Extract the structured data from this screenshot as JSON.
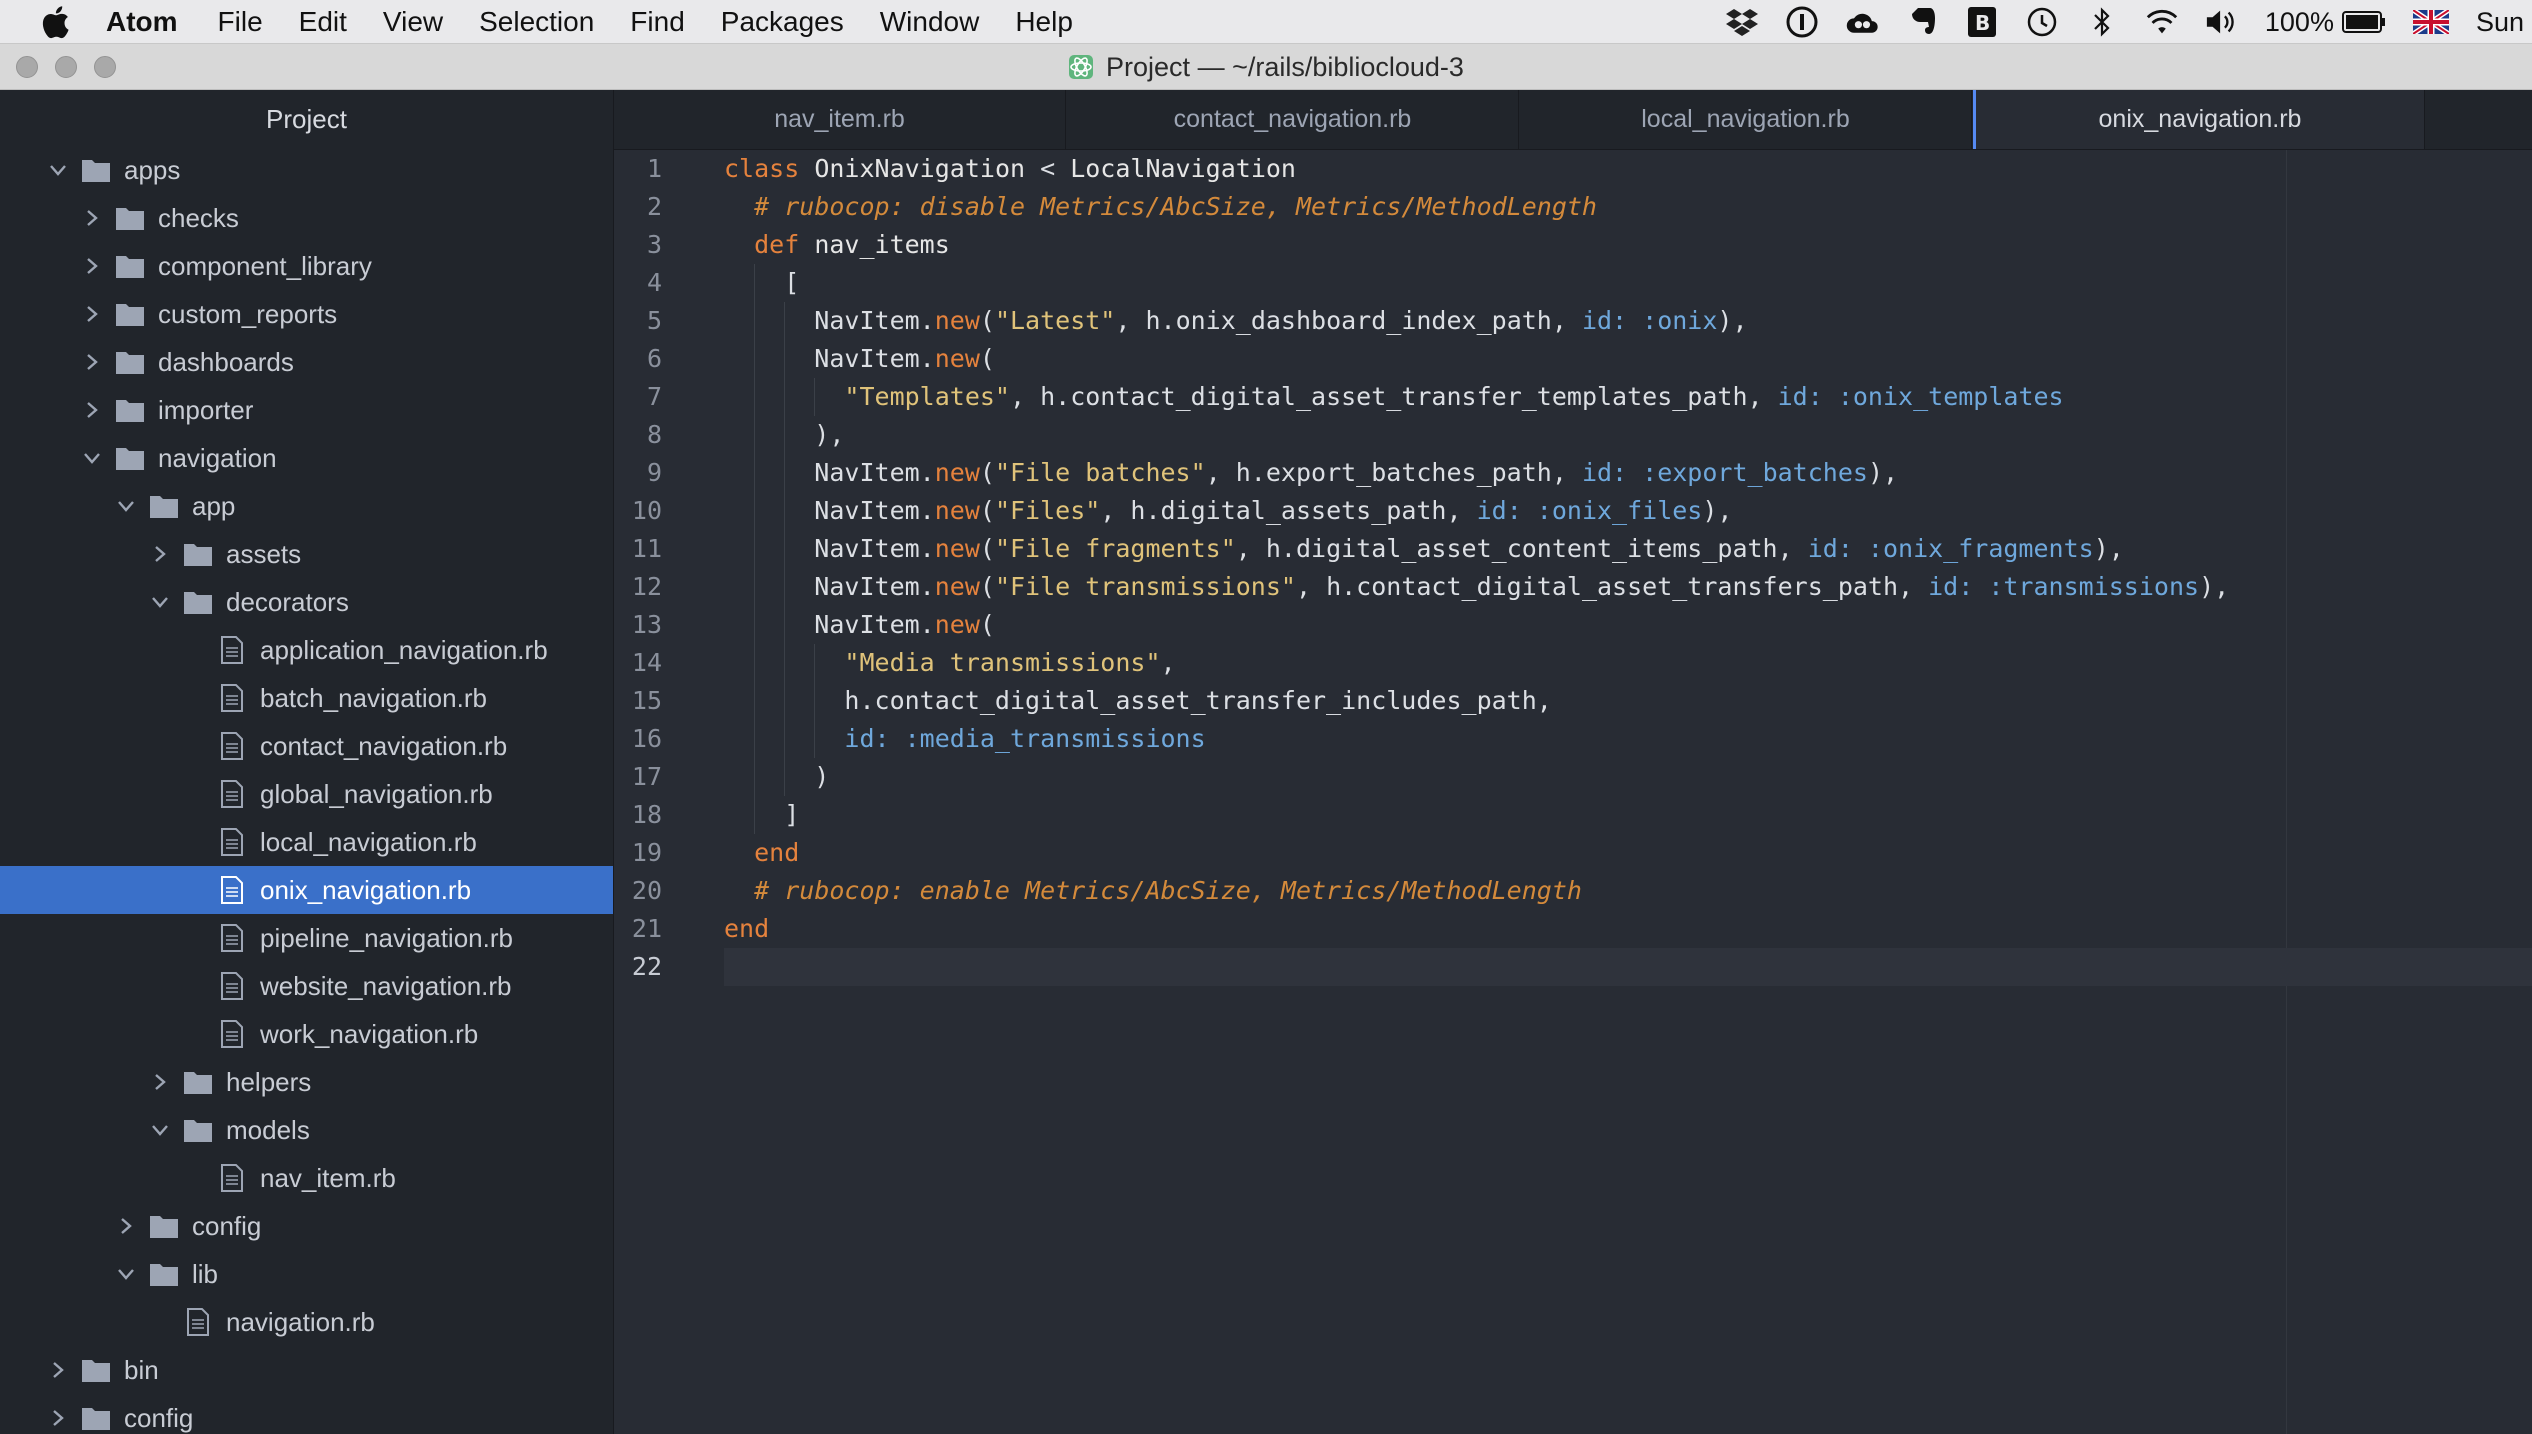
{
  "menubar": {
    "items": [
      "Atom",
      "File",
      "Edit",
      "View",
      "Selection",
      "Find",
      "Packages",
      "Window",
      "Help"
    ],
    "status": {
      "icons": [
        "dropbox-icon",
        "onepassword-icon",
        "creative-cloud-icon",
        "evernote-icon",
        "bear-icon",
        "time-machine-icon",
        "bluetooth-icon",
        "wifi-icon",
        "volume-icon"
      ],
      "battery_text": "100%",
      "clock_text": "Sun"
    }
  },
  "window": {
    "title": "Project — ~/rails/bibliocloud-3"
  },
  "tree": {
    "header": "Project",
    "selected": "onix_navigation.rb",
    "rows": [
      {
        "label": "apps",
        "type": "folder",
        "expanded": true,
        "depth": 0
      },
      {
        "label": "checks",
        "type": "folder",
        "expanded": false,
        "depth": 1
      },
      {
        "label": "component_library",
        "type": "folder",
        "expanded": false,
        "depth": 1
      },
      {
        "label": "custom_reports",
        "type": "folder",
        "expanded": false,
        "depth": 1
      },
      {
        "label": "dashboards",
        "type": "folder",
        "expanded": false,
        "depth": 1
      },
      {
        "label": "importer",
        "type": "folder",
        "expanded": false,
        "depth": 1
      },
      {
        "label": "navigation",
        "type": "folder",
        "expanded": true,
        "depth": 1
      },
      {
        "label": "app",
        "type": "folder",
        "expanded": true,
        "depth": 2
      },
      {
        "label": "assets",
        "type": "folder",
        "expanded": false,
        "depth": 3
      },
      {
        "label": "decorators",
        "type": "folder",
        "expanded": true,
        "depth": 3
      },
      {
        "label": "application_navigation.rb",
        "type": "file",
        "depth": 4
      },
      {
        "label": "batch_navigation.rb",
        "type": "file",
        "depth": 4
      },
      {
        "label": "contact_navigation.rb",
        "type": "file",
        "depth": 4
      },
      {
        "label": "global_navigation.rb",
        "type": "file",
        "depth": 4
      },
      {
        "label": "local_navigation.rb",
        "type": "file",
        "depth": 4
      },
      {
        "label": "onix_navigation.rb",
        "type": "file",
        "depth": 4
      },
      {
        "label": "pipeline_navigation.rb",
        "type": "file",
        "depth": 4
      },
      {
        "label": "website_navigation.rb",
        "type": "file",
        "depth": 4
      },
      {
        "label": "work_navigation.rb",
        "type": "file",
        "depth": 4
      },
      {
        "label": "helpers",
        "type": "folder",
        "expanded": false,
        "depth": 3
      },
      {
        "label": "models",
        "type": "folder",
        "expanded": true,
        "depth": 3
      },
      {
        "label": "nav_item.rb",
        "type": "file",
        "depth": 4
      },
      {
        "label": "config",
        "type": "folder",
        "expanded": false,
        "depth": 2
      },
      {
        "label": "lib",
        "type": "folder",
        "expanded": true,
        "depth": 2
      },
      {
        "label": "navigation.rb",
        "type": "file",
        "depth": 3
      },
      {
        "label": "bin",
        "type": "folder",
        "expanded": false,
        "depth": 0
      },
      {
        "label": "config",
        "type": "folder",
        "expanded": false,
        "depth": 0
      }
    ]
  },
  "tabs": [
    {
      "label": "nav_item.rb",
      "active": false
    },
    {
      "label": "contact_navigation.rb",
      "active": false
    },
    {
      "label": "local_navigation.rb",
      "active": false
    },
    {
      "label": "onix_navigation.rb",
      "active": true
    }
  ],
  "editor": {
    "cursor_line": 22,
    "lines": [
      [
        [
          "kw",
          "class"
        ],
        [
          "t",
          " "
        ],
        [
          "cls",
          "OnixNavigation"
        ],
        [
          "t",
          " < "
        ],
        [
          "cls",
          "LocalNavigation"
        ]
      ],
      [
        [
          "t",
          "  "
        ],
        [
          "cm",
          "# rubocop: disable Metrics/AbcSize, Metrics/MethodLength"
        ]
      ],
      [
        [
          "t",
          "  "
        ],
        [
          "kw",
          "def"
        ],
        [
          "t",
          " "
        ],
        [
          "id",
          "nav_items"
        ]
      ],
      [
        [
          "t",
          "    ["
        ]
      ],
      [
        [
          "t",
          "      NavItem."
        ],
        [
          "mth",
          "new"
        ],
        [
          "t",
          "("
        ],
        [
          "str",
          "\"Latest\""
        ],
        [
          "t",
          ", h.onix_dashboard_index_path, "
        ],
        [
          "sym",
          "id: :onix"
        ],
        [
          "t",
          "),"
        ]
      ],
      [
        [
          "t",
          "      NavItem."
        ],
        [
          "mth",
          "new"
        ],
        [
          "t",
          "("
        ]
      ],
      [
        [
          "t",
          "        "
        ],
        [
          "str",
          "\"Templates\""
        ],
        [
          "t",
          ", h.contact_digital_asset_transfer_templates_path, "
        ],
        [
          "sym",
          "id: :onix_templates"
        ]
      ],
      [
        [
          "t",
          "      ),"
        ]
      ],
      [
        [
          "t",
          "      NavItem."
        ],
        [
          "mth",
          "new"
        ],
        [
          "t",
          "("
        ],
        [
          "str",
          "\"File batches\""
        ],
        [
          "t",
          ", h.export_batches_path, "
        ],
        [
          "sym",
          "id: :export_batches"
        ],
        [
          "t",
          "),"
        ]
      ],
      [
        [
          "t",
          "      NavItem."
        ],
        [
          "mth",
          "new"
        ],
        [
          "t",
          "("
        ],
        [
          "str",
          "\"Files\""
        ],
        [
          "t",
          ", h.digital_assets_path, "
        ],
        [
          "sym",
          "id: :onix_files"
        ],
        [
          "t",
          "),"
        ]
      ],
      [
        [
          "t",
          "      NavItem."
        ],
        [
          "mth",
          "new"
        ],
        [
          "t",
          "("
        ],
        [
          "str",
          "\"File fragments\""
        ],
        [
          "t",
          ", h.digital_asset_content_items_path, "
        ],
        [
          "sym",
          "id: :onix_fragments"
        ],
        [
          "t",
          "),"
        ]
      ],
      [
        [
          "t",
          "      NavItem."
        ],
        [
          "mth",
          "new"
        ],
        [
          "t",
          "("
        ],
        [
          "str",
          "\"File transmissions\""
        ],
        [
          "t",
          ", h.contact_digital_asset_transfers_path, "
        ],
        [
          "sym",
          "id: :transmissions"
        ],
        [
          "t",
          "),"
        ]
      ],
      [
        [
          "t",
          "      NavItem."
        ],
        [
          "mth",
          "new"
        ],
        [
          "t",
          "("
        ]
      ],
      [
        [
          "t",
          "        "
        ],
        [
          "str",
          "\"Media transmissions\""
        ],
        [
          "t",
          ","
        ]
      ],
      [
        [
          "t",
          "        h.contact_digital_asset_transfer_includes_path,"
        ]
      ],
      [
        [
          "t",
          "        "
        ],
        [
          "sym",
          "id: :media_transmissions"
        ]
      ],
      [
        [
          "t",
          "      )"
        ]
      ],
      [
        [
          "t",
          "    ]"
        ]
      ],
      [
        [
          "t",
          "  "
        ],
        [
          "kw",
          "end"
        ]
      ],
      [
        [
          "t",
          "  "
        ],
        [
          "cm",
          "# rubocop: enable Metrics/AbcSize, Metrics/MethodLength"
        ]
      ],
      [
        [
          "kw",
          "end"
        ]
      ],
      [
        [
          "t",
          ""
        ]
      ]
    ]
  }
}
